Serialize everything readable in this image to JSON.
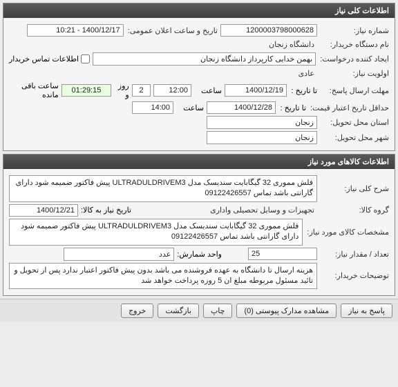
{
  "panel1": {
    "title": "اطلاعات کلی نیاز",
    "need_no_lbl": "شماره نیاز:",
    "need_no": "1200003798000628",
    "pub_date_lbl": "تاریخ و ساعت اعلان عمومی:",
    "pub_date": "1400/12/17 - 10:21",
    "buyer_lbl": "نام دستگاه خریدار:",
    "buyer": "دانشگاه زنجان",
    "creator_lbl": "ایجاد کننده درخواست:",
    "creator": "بهمن خدایی کارپرداز دانشگاه زنجان",
    "buyer_contact_cb": "اطلاعات تماس خریدار",
    "priority_lbl": "اولویت نیاز:",
    "priority": "عادی",
    "reply_deadline_lbl": "مهلت ارسال پاسخ:",
    "to_date_lbl": "تا تاریخ :",
    "reply_date": "1400/12/19",
    "time_lbl": "ساعت",
    "reply_time": "12:00",
    "days": "2",
    "days_lbl": "روز و",
    "countdown": "01:29:15",
    "remain_lbl": "ساعت باقی مانده",
    "price_valid_lbl": "حداقل تاریخ اعتبار قیمت:",
    "price_valid_date": "1400/12/28",
    "price_valid_time": "14:00",
    "deliver_prov_lbl": "استان محل تحویل:",
    "deliver_prov": "زنجان",
    "deliver_city_lbl": "شهر محل تحویل:",
    "deliver_city": "زنجان"
  },
  "panel2": {
    "title": "اطلاعات کالاهای مورد نیاز",
    "desc_lbl": "شرح کلی نیاز:",
    "desc": "فلش مموری 32 گیگابایت سندیسک مدل ULTRADULDRIVEM3  پیش فاکتور ضمیمه شود دارای گارانتی باشد تماس 09122426557",
    "group_lbl": "گروه کالا:",
    "group": "تجهیزات و وسایل تحصیلی واداری",
    "need_to_date_lbl": "تاریخ نیاز به کالا:",
    "need_to_date": "1400/12/21",
    "spec_lbl": "مشخصات کالای مورد نیاز:",
    "spec": "فلش مموری 32 گیگابایت سندیسک مدل ULTRADULDRIVEM3  پیش فاکتور ضمیمه شود دارای گارانتی باشد تماس 09122426557",
    "qty_lbl": "تعداد / مقدار نیاز:",
    "qty": "25",
    "unit_lbl": "واحد شمارش:",
    "unit": "عدد",
    "buyer_notes_lbl": "توضیحات خریدار:",
    "buyer_notes": "هزینه ارسال تا دانشگاه به عهده فروشنده می باشد بدون پیش فاکتور اعتبار ندارد پس از تحویل و تائید مسئول مربوطه مبلغ ان 5 روزه پرداخت خواهد شد"
  },
  "footer": {
    "reply": "پاسخ به نیاز",
    "view_attach": "مشاهده مدارک پیوستی (0)",
    "print": "چاپ",
    "back": "بازگشت",
    "exit": "خروج"
  }
}
